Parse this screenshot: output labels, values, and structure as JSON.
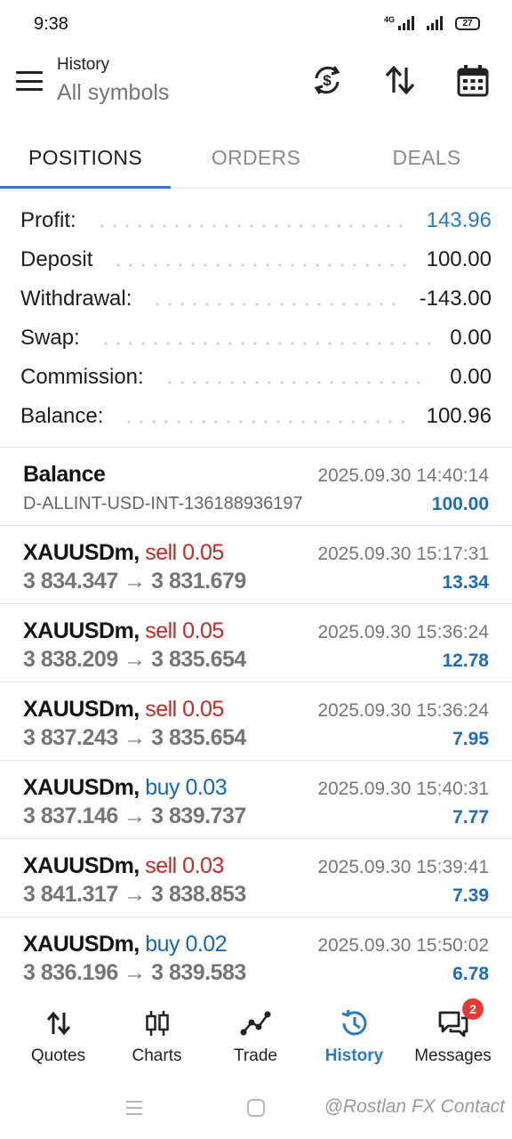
{
  "status": {
    "time": "9:38",
    "network": "4G",
    "battery": "27"
  },
  "appbar": {
    "title": "History",
    "subtitle": "All symbols"
  },
  "tabs": [
    {
      "label": "POSITIONS",
      "active": true
    },
    {
      "label": "ORDERS",
      "active": false
    },
    {
      "label": "DEALS",
      "active": false
    }
  ],
  "summary": [
    {
      "label": "Profit:",
      "value": "143.96"
    },
    {
      "label": "Deposit",
      "value": "100.00"
    },
    {
      "label": "Withdrawal:",
      "value": "-143.00"
    },
    {
      "label": "Swap:",
      "value": "0.00"
    },
    {
      "label": "Commission:",
      "value": "0.00"
    },
    {
      "label": "Balance:",
      "value": "100.96"
    }
  ],
  "balance_entry": {
    "title": "Balance",
    "account": "D-ALLINT-USD-INT-136188936197",
    "time": "2025.09.30 14:40:14",
    "amount": "100.00"
  },
  "positions": [
    {
      "symbol": "XAUUSDm,",
      "side": "sell 0.05",
      "prices": "3 834.347 → 3 831.679",
      "time": "2025.09.30 15:17:31",
      "profit": "13.34"
    },
    {
      "symbol": "XAUUSDm,",
      "side": "sell 0.05",
      "prices": "3 838.209 → 3 835.654",
      "time": "2025.09.30 15:36:24",
      "profit": "12.78"
    },
    {
      "symbol": "XAUUSDm,",
      "side": "sell 0.05",
      "prices": "3 837.243 → 3 835.654",
      "time": "2025.09.30 15:36:24",
      "profit": "7.95"
    },
    {
      "symbol": "XAUUSDm,",
      "side": "buy 0.03",
      "prices": "3 837.146 → 3 839.737",
      "time": "2025.09.30 15:40:31",
      "profit": "7.77"
    },
    {
      "symbol": "XAUUSDm,",
      "side": "sell 0.03",
      "prices": "3 841.317 → 3 838.853",
      "time": "2025.09.30 15:39:41",
      "profit": "7.39"
    },
    {
      "symbol": "XAUUSDm,",
      "side": "buy 0.02",
      "prices": "3 836.196 → 3 839.583",
      "time": "2025.09.30 15:50:02",
      "profit": "6.78"
    }
  ],
  "bottom_nav": [
    {
      "label": "Quotes",
      "icon": "quotes-arrows-icon"
    },
    {
      "label": "Charts",
      "icon": "candlestick-icon"
    },
    {
      "label": "Trade",
      "icon": "trade-line-icon"
    },
    {
      "label": "History",
      "icon": "history-clock-icon",
      "active": true
    },
    {
      "label": "Messages",
      "icon": "messages-icon",
      "badge": "2"
    }
  ],
  "watermark": "@Rostlan FX Contact",
  "colors": {
    "accent": "#2b79c2",
    "sell": "#c62828",
    "buy": "#1565c0",
    "profit": "#1e6bb8"
  }
}
